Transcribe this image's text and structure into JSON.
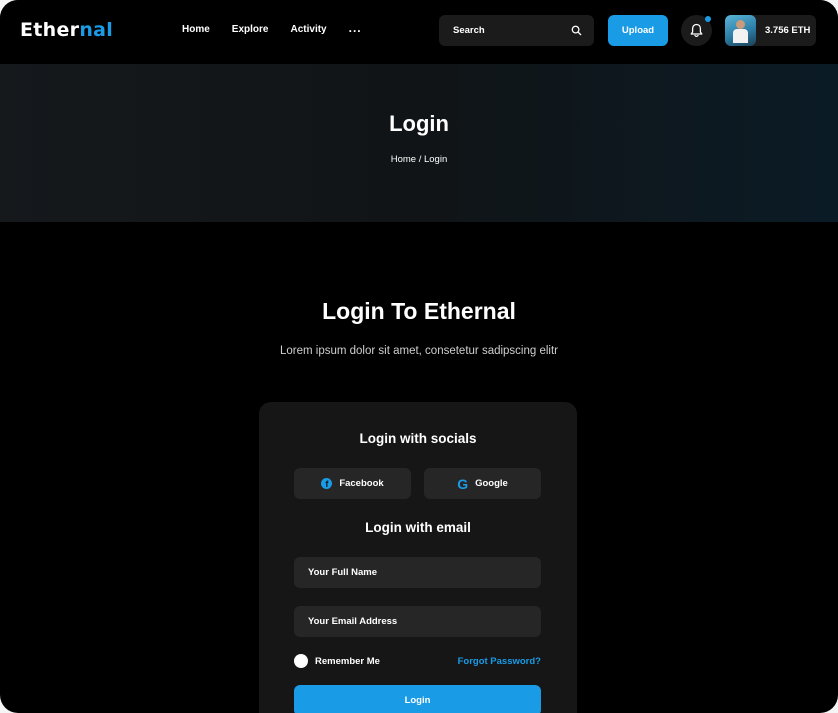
{
  "header": {
    "logo_main": "Ether",
    "logo_accent": "nal",
    "nav": [
      "Home",
      "Explore",
      "Activity",
      "..."
    ],
    "search_placeholder": "Search",
    "upload_label": "Upload",
    "balance": "3.756 ETH"
  },
  "banner": {
    "title": "Login",
    "breadcrumb": "Home / Login"
  },
  "main": {
    "title": "Login To Ethernal",
    "subtitle": "Lorem ipsum dolor sit amet, consetetur sadipscing elitr"
  },
  "card": {
    "socials_heading": "Login with socials",
    "facebook_label": "Facebook",
    "google_label": "Google",
    "email_heading": "Login with email",
    "name_placeholder": "Your Full Name",
    "email_placeholder": "Your Email Address",
    "remember_label": "Remember Me",
    "forgot_label": "Forgot Password?",
    "login_label": "Login"
  },
  "colors": {
    "accent": "#1a9be6",
    "background": "#000000",
    "card": "#161616",
    "input": "#262626"
  }
}
